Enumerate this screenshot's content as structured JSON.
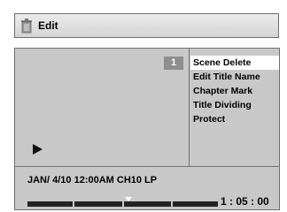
{
  "header": {
    "title": "Edit",
    "icon": "trash-icon"
  },
  "preview": {
    "title_number": "1",
    "play_icon": "play-icon"
  },
  "menu": {
    "items": [
      {
        "label": "Scene Delete",
        "selected": true
      },
      {
        "label": "Edit Title Name",
        "selected": false
      },
      {
        "label": "Chapter Mark",
        "selected": false
      },
      {
        "label": "Title Dividing",
        "selected": false
      },
      {
        "label": "Protect",
        "selected": false
      }
    ]
  },
  "status": {
    "info": "JAN/ 4/10 12:00AM CH10   LP",
    "time": "1 : 05 : 00"
  },
  "colors": {
    "panel": "#c8c8c8",
    "selected_bg": "#ffffff",
    "badge_bg": "#8e8e8e"
  }
}
